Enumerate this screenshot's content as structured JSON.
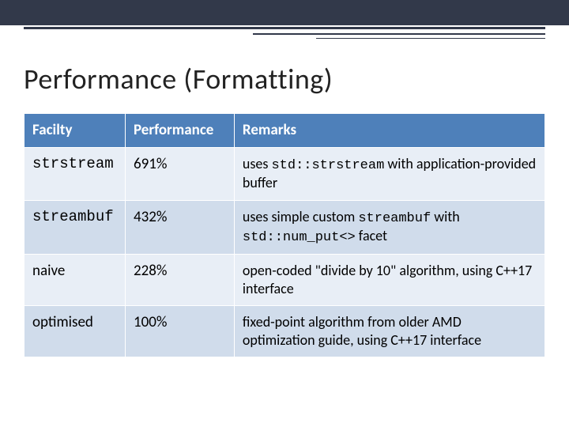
{
  "title": "Performance (Formatting)",
  "headers": {
    "facility": "Facilty",
    "performance": "Performance",
    "remarks": "Remarks"
  },
  "rows": [
    {
      "facility": "strstream",
      "facility_mono": true,
      "performance": "691%",
      "remarks_pre": "uses ",
      "remarks_code": "std::strstream",
      "remarks_post": " with application-provided buffer"
    },
    {
      "facility": "streambuf",
      "facility_mono": true,
      "performance": "432%",
      "remarks_pre": "uses simple custom ",
      "remarks_code": "streambuf",
      "remarks_mid": " with ",
      "remarks_code2": "std::num_put<>",
      "remarks_post": " facet"
    },
    {
      "facility": "naive",
      "facility_mono": false,
      "performance": "228%",
      "remarks_pre": "open-coded \"divide by 10\" algorithm, using C++17 interface",
      "remarks_code": "",
      "remarks_post": ""
    },
    {
      "facility": "optimised",
      "facility_mono": false,
      "performance": "100%",
      "remarks_pre": "fixed-point algorithm from older AMD optimization guide, using C++17 interface",
      "remarks_code": "",
      "remarks_post": ""
    }
  ]
}
